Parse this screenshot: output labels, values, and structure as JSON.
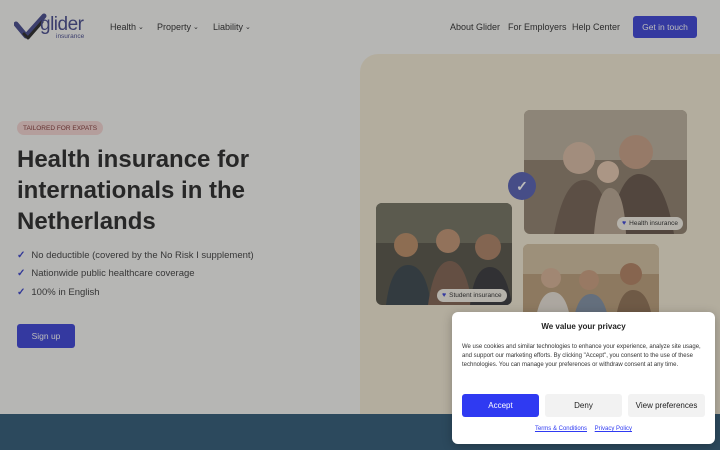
{
  "brand": {
    "name": "glider",
    "tagline": "insurance",
    "color": "#3b3f86"
  },
  "nav": {
    "left": [
      {
        "label": "Health"
      },
      {
        "label": "Property"
      },
      {
        "label": "Liability"
      }
    ],
    "right": [
      {
        "label": "About Glider"
      },
      {
        "label": "For Employers"
      },
      {
        "label": "Help Center"
      }
    ],
    "cta": "Get in touch"
  },
  "hero": {
    "tag": "TAILORED FOR EXPATS",
    "title": "Health insurance for internationals in the Netherlands",
    "features": [
      "No deductible (covered by the No Risk I supplement)",
      "Nationwide public healthcare coverage",
      "100% in English"
    ],
    "signup": "Sign up"
  },
  "images": {
    "health_badge": "Health insurance",
    "student_badge": "Student insurance"
  },
  "cookie": {
    "title": "We value your privacy",
    "text": "We use cookies and similar technologies to enhance your experience, analyze site usage, and support our marketing efforts. By clicking \"Accept\", you consent to the use of these technologies. You can manage your preferences or withdraw consent at any time.",
    "accept": "Accept",
    "deny": "Deny",
    "preferences": "View preferences",
    "terms": "Terms & Conditions",
    "privacy": "Privacy Policy"
  },
  "colors": {
    "accent": "#3038d6",
    "panel": "#f3ead3",
    "band": "#24506f"
  }
}
